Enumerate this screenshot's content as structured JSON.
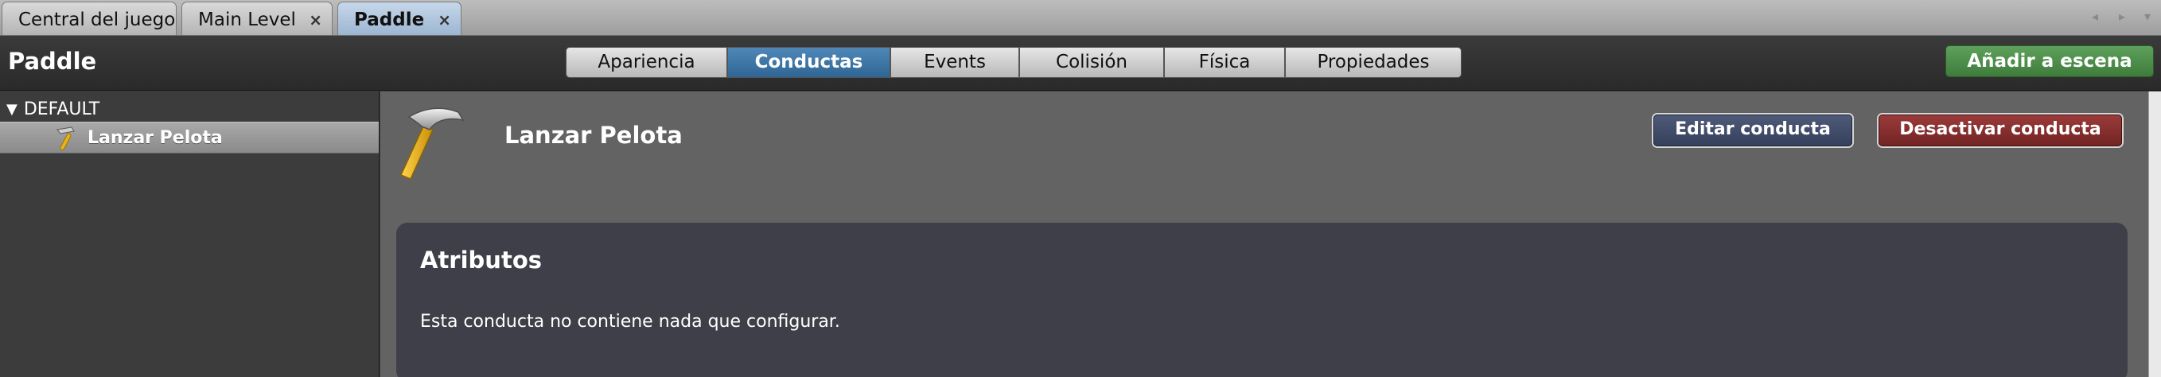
{
  "doc_tabs": [
    {
      "label": "Central del juego",
      "closable": false,
      "active": false
    },
    {
      "label": "Main Level",
      "closable": true,
      "active": false
    },
    {
      "label": "Paddle",
      "closable": true,
      "active": true
    }
  ],
  "doc_tab_close_glyph": "×",
  "strip_controls": [
    "◂",
    "▸",
    "▾"
  ],
  "toolbar": {
    "actor_title": "Paddle",
    "segments": [
      "Apariencia",
      "Conductas",
      "Events",
      "Colisión",
      "Física",
      "Propiedades"
    ],
    "active_segment": "Conductas",
    "add_to_scene_label": "Añadir a escena"
  },
  "left_panel": {
    "group_toggle_glyph": "▼",
    "group_label": "DEFAULT",
    "behaviors": [
      {
        "label": "Lanzar Pelota",
        "icon": "hammer-icon",
        "selected": true
      }
    ]
  },
  "main": {
    "behavior_icon": "hammer-icon",
    "behavior_title": "Lanzar Pelota",
    "edit_button_label": "Editar conducta",
    "deactivate_button_label": "Desactivar conducta",
    "attributes_title": "Atributos",
    "attributes_message": "Esta conducta no contiene nada que configurar."
  },
  "colors": {
    "active_segment": "#3d77a8",
    "add_button": "#4e8e4b",
    "edit_button": "#3e4a68",
    "deactivate_button": "#862e2e",
    "attributes_panel": "#3f3f49"
  }
}
